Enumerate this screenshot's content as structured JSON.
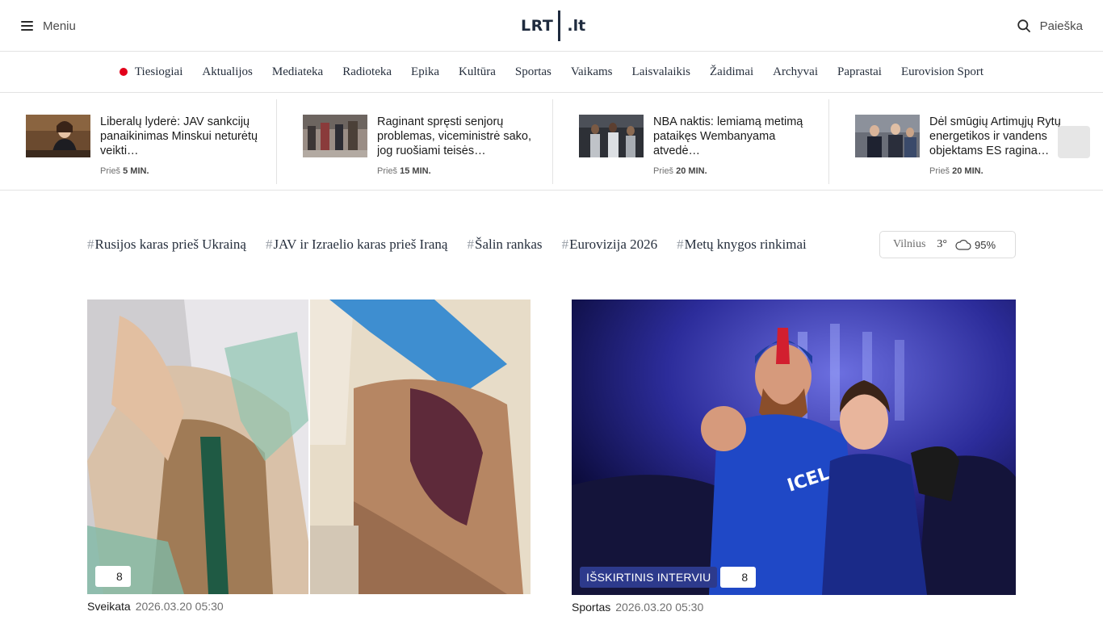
{
  "header": {
    "menu_label": "Meniu",
    "logo_left": "LRT",
    "logo_right": ".lt",
    "search_label": "Paieška"
  },
  "nav": {
    "items": [
      "Tiesiogiai",
      "Aktualijos",
      "Mediateka",
      "Radioteka",
      "Epika",
      "Kultūra",
      "Sportas",
      "Vaikams",
      "Laisvalaikis",
      "Žaidimai",
      "Archyvai",
      "Paprastai",
      "Eurovision Sport"
    ],
    "live_color": "#e2001a"
  },
  "ticker": {
    "items": [
      {
        "title": "Liberalų lyderė: JAV sankcijų panaikinimas Minskui neturėtų veikti…",
        "prefix": "Prieš",
        "time": "5 MIN."
      },
      {
        "title": "Raginant spręsti senjorų problemas, viceministrė sako, jog ruošiami teisės…",
        "prefix": "Prieš",
        "time": "15 MIN."
      },
      {
        "title": "NBA naktis: lemiamą metimą pataikęs Wembanyama atvedė…",
        "prefix": "Prieš",
        "time": "20 MIN."
      },
      {
        "title": "Dėl smūgių Artimųjų Rytų energetikos ir vandens objektams ES ragina…",
        "prefix": "Prieš",
        "time": "20 MIN."
      }
    ]
  },
  "tags": {
    "hash": "#",
    "items": [
      "Rusijos karas prieš Ukrainą",
      "JAV ir Izraelio karas prieš Iraną",
      "Šalin rankas",
      "Eurovizija 2026",
      "Metų knygos rinkimai"
    ]
  },
  "weather": {
    "city": "Vilnius",
    "temp": "3°",
    "humidity": "95%",
    "icon": "cloud-icon"
  },
  "articles": [
    {
      "category": "Sveikata",
      "date": "2026.03.20 05:30",
      "comments": "8",
      "badge": ""
    },
    {
      "category": "Sportas",
      "date": "2026.03.20 05:30",
      "comments": "8",
      "badge": "IŠSKIRTINIS INTERVIU"
    }
  ],
  "colors": {
    "accent": "#2d3a8c",
    "text": "#262f3d",
    "border": "#e3e3e3"
  }
}
